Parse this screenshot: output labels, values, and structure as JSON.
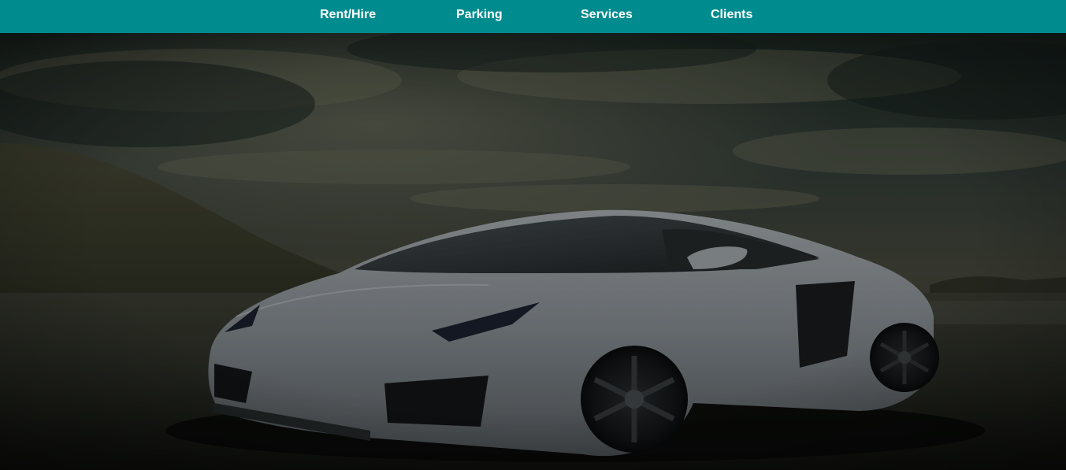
{
  "nav": {
    "items": [
      {
        "label": "Rent/Hire"
      },
      {
        "label": "Parking"
      },
      {
        "label": "Services"
      },
      {
        "label": "Clients"
      }
    ],
    "background_color": "#008b8f",
    "text_color": "#ffffff"
  },
  "hero": {
    "image": "sports-car-photo",
    "overlay_color": "#000000"
  }
}
